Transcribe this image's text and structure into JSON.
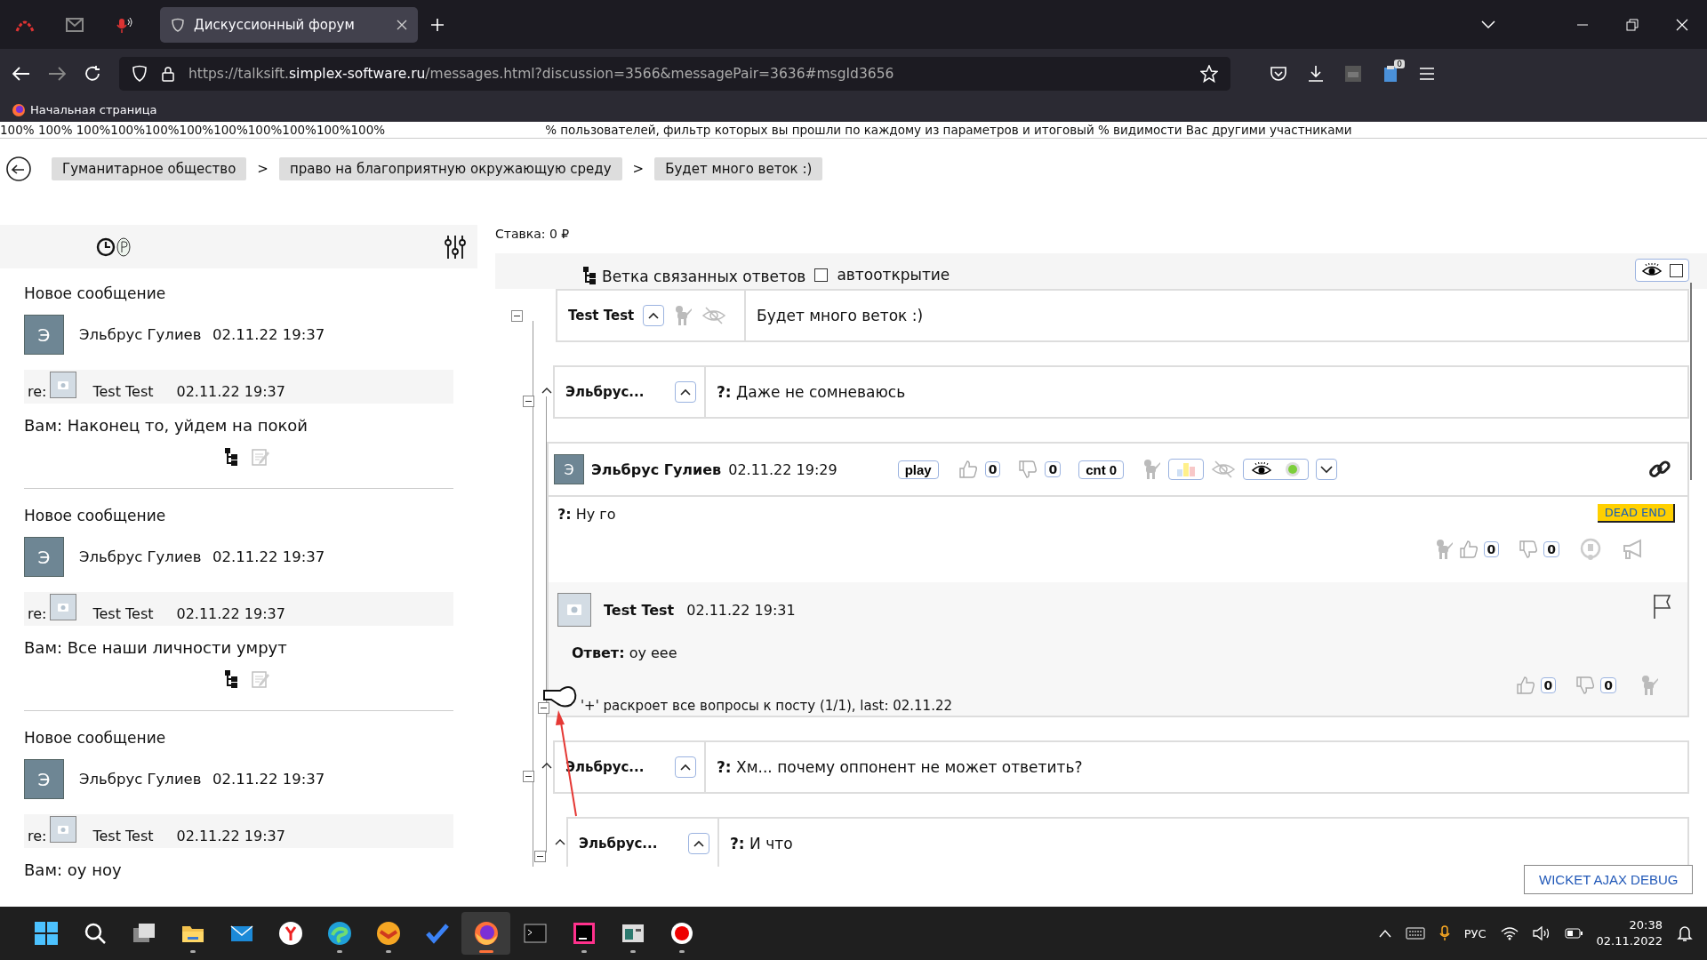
{
  "browser": {
    "pinned_tabs": [
      {
        "kind": "arc"
      },
      {
        "kind": "mail"
      },
      {
        "kind": "mic"
      }
    ],
    "tab_title": "Дискуссионный форум",
    "url": {
      "prefix": "https://talksift.",
      "domain": "simplex-software.ru",
      "path": "/messages.html?discussion=3566&messagePair=3636#msgId3656"
    },
    "extension_badge": "0",
    "bookmark": "Начальная страница"
  },
  "top_strip": {
    "percentages": "100% 100% 100%100%100%100%100%100%100%100%100%",
    "note": "% пользователей, фильтр которых вы прошли по каждому из параметров и итоговый % видимости Вас другими участниками"
  },
  "breadcrumbs": [
    {
      "kind": "crumb",
      "text": "Гуманитарное общество"
    },
    {
      "kind": "separator",
      "text": ">"
    },
    {
      "kind": "crumb",
      "text": "право на благоприятную окружающую среду"
    },
    {
      "kind": "separator",
      "text": ">"
    },
    {
      "kind": "crumb",
      "text": "Будет много веток :)"
    }
  ],
  "feed": [
    {
      "title": "Новое сообщение",
      "avatar": "Э",
      "author": "Эльбрус Гулиев",
      "time": "02.11.22 19:37",
      "reply_label": "re:",
      "reply_author": "Test Test",
      "reply_time": "02.11.22 19:37",
      "text": "Вам: Наконец то, уйдем на покой",
      "actions_shown": true
    },
    {
      "title": "Новое сообщение",
      "avatar": "Э",
      "author": "Эльбрус Гулиев",
      "time": "02.11.22 19:37",
      "reply_label": "re:",
      "reply_author": "Test Test",
      "reply_time": "02.11.22 19:37",
      "text": "Вам: Все наши личности умрут",
      "actions_shown": true
    },
    {
      "title": "Новое сообщение",
      "avatar": "Э",
      "author": "Эльбрус Гулиев",
      "time": "02.11.22 19:37",
      "reply_label": "re:",
      "reply_author": "Test Test",
      "reply_time": "02.11.22 19:37",
      "text": "Вам: оу ноу",
      "actions_shown": false
    }
  ],
  "main": {
    "stake": "Ставка: 0 ₽",
    "branch_label": "Ветка связанных ответов",
    "autoopen": {
      "label": "автооткрытие",
      "checked": false
    },
    "show_all_checked": false,
    "thread": {
      "kind": "root",
      "author": "Test Test",
      "text": "Будет много веток :)",
      "children": [
        {
          "kind": "question",
          "author": "Эльбрус...",
          "prefix": "?:",
          "text": "Даже не сомневаюсь",
          "post": {
            "avatar": "Э",
            "author": "Эльбрус Гулиев",
            "time": "02.11.22 19:29",
            "play": "play",
            "likes": "0",
            "dislikes": "0",
            "cnt": "cnt 0",
            "prefix": "?:",
            "text": "Ну го",
            "badge": "DEAD END",
            "bottom_likes": "0",
            "bottom_dislikes": "0",
            "answer": {
              "author": "Test Test",
              "time": "02.11.22 19:31",
              "label": "Ответ:",
              "text": "оу еее",
              "likes": "0",
              "dislikes": "0"
            },
            "footer": "'+' раскроет все вопросы к посту (1/1), last: 02.11.22"
          }
        },
        {
          "kind": "question",
          "author": "Эльбрус...",
          "prefix": "?:",
          "text": "Хм... почему оппонент не может ответить?",
          "children": [
            {
              "kind": "question",
              "author": "Эльбрус...",
              "prefix": "?:",
              "text": "И что"
            }
          ]
        }
      ]
    },
    "debug_button": "WICKET AJAX DEBUG"
  },
  "taskbar": {
    "apps": [
      {
        "kind": "start",
        "running": false,
        "selected": false
      },
      {
        "kind": "search",
        "running": false,
        "selected": false
      },
      {
        "kind": "taskview",
        "running": false,
        "selected": false
      },
      {
        "kind": "folder",
        "running": true,
        "selected": false
      },
      {
        "kind": "mail",
        "running": false,
        "selected": false
      },
      {
        "kind": "circle",
        "running": false,
        "selected": false
      },
      {
        "kind": "edge",
        "running": true,
        "selected": false
      },
      {
        "kind": "orange",
        "running": true,
        "selected": false
      },
      {
        "kind": "check",
        "running": false,
        "selected": false
      },
      {
        "kind": "firefox",
        "running": true,
        "selected": true
      },
      {
        "kind": "terminal",
        "running": false,
        "selected": false
      },
      {
        "kind": "ide",
        "running": true,
        "selected": false
      },
      {
        "kind": "window",
        "running": true,
        "selected": false
      },
      {
        "kind": "record",
        "running": true,
        "selected": false
      }
    ],
    "language": "РУС",
    "time": "20:38",
    "date": "02.11.2022"
  }
}
